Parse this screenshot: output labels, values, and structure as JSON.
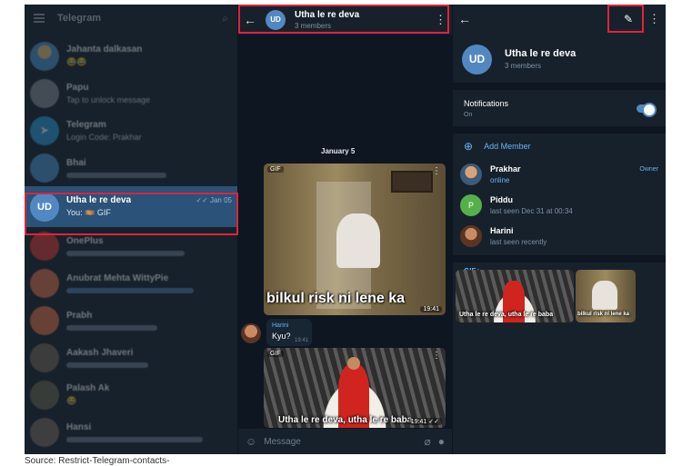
{
  "left_panel": {
    "title": "Telegram",
    "chats": [
      {
        "name": "Jahanta dalkasan",
        "preview": "😂😂",
        "time": "",
        "avatar_color": "#4f9ad8"
      },
      {
        "name": "Papu",
        "preview": "Tap to unlock message",
        "time": "",
        "avatar_color": "#8a8f99"
      },
      {
        "name": "Telegram",
        "preview": "Login Code: Prakhar",
        "time": "",
        "avatar_color": "#2aa3e0"
      },
      {
        "name": "Bhai",
        "preview": "",
        "time": "",
        "avatar_color": "#4f9ad8"
      },
      {
        "name": "Utha le re deva",
        "preview": "You: 🎞️ GIF",
        "time": "Jan 05",
        "initials": "UD",
        "avatar_color": "#5288c1",
        "active": true
      },
      {
        "name": "OnePlus",
        "preview": "",
        "time": "",
        "avatar_color": "#e53935"
      },
      {
        "name": "Anubrat Mehta WittyPie",
        "preview": "",
        "time": "",
        "avatar_color": "#e8734a"
      },
      {
        "name": "Prabh",
        "preview": "",
        "time": "",
        "avatar_color": "#e8734a"
      },
      {
        "name": "Aakash Jhaveri",
        "preview": "",
        "time": "",
        "avatar_color": "#7a6a5a"
      },
      {
        "name": "Palash Ak",
        "preview": "😂",
        "time": "",
        "avatar_color": "#6d6a4f"
      },
      {
        "name": "Hansi",
        "preview": "",
        "time": "",
        "avatar_color": "#7f6b60"
      }
    ]
  },
  "chat": {
    "group_initials": "UD",
    "group_name": "Utha le re deva",
    "members_text": "3 members",
    "date_label": "January 5",
    "gif_tag": "GIF",
    "gif1_caption": "bilkul risk ni lene ka",
    "gif1_time": "19:41",
    "harini_name": "Harini",
    "harini_text": "Kyu?",
    "harini_time": "19:41",
    "gif2_caption": "Utha le re deva, utha le re baba",
    "gif2_time": "19:41",
    "composer_placeholder": "Message"
  },
  "info_panel": {
    "group_initials": "UD",
    "group_name": "Utha le re deva",
    "members_text": "3 members",
    "notifications_label": "Notifications",
    "notifications_state": "On",
    "add_member_label": "Add Member",
    "members": [
      {
        "name": "Prakhar",
        "status": "online",
        "role": "Owner",
        "avatar_color": "#8a6a4a"
      },
      {
        "name": "Piddu",
        "status": "last seen Dec 31 at 00:34",
        "role": "",
        "initial": "P",
        "avatar_color": "#55b04a"
      },
      {
        "name": "Harini",
        "status": "last seen recently",
        "role": "",
        "avatar_color": "#a0663f"
      }
    ],
    "gifs_tab": "GIFs",
    "gif_a_caption": "Utha le re deva, utha le re baba",
    "gif_b_caption": "bilkul risk ni lene ka"
  },
  "footer": {
    "source": "Source: Restrict-Telegram-contacts-"
  },
  "colors": {
    "accent": "#5288c1",
    "highlight": "#e0223b",
    "link": "#6ab3f3"
  }
}
